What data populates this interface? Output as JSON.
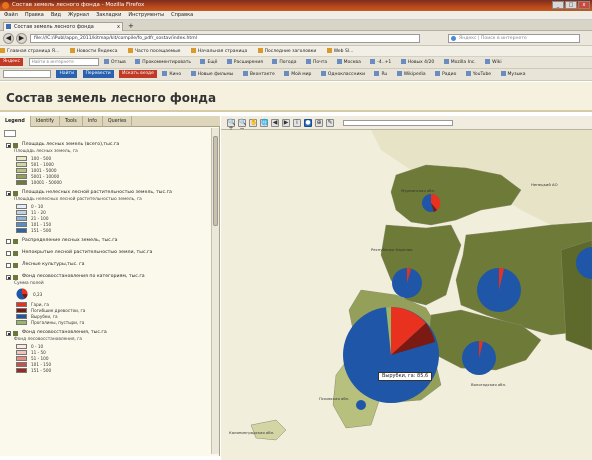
{
  "window": {
    "title": "Состав земель лесного фонда - Mozilla Firefox",
    "min": "_",
    "max": "□",
    "close": "x"
  },
  "menu": [
    "Файл",
    "Правка",
    "Вид",
    "Журнал",
    "Закладки",
    "Инструменты",
    "Справка"
  ],
  "tab": {
    "title": "Состав земель лесного фонда",
    "close": "x",
    "new": "+"
  },
  "nav": {
    "back": "◀",
    "forward": "▶",
    "url": "file:///C:/iPubl/appn_2011/kitmap/kit/compile/fo_pdfr_sostav/index.html",
    "search_placeholder": "Яндекс | Поиск в интернете"
  },
  "bookmarks": [
    "Главная страница Я...",
    "Новости Яндекса",
    "Часто посещаемые",
    "Начальная страница",
    "Последние заголовки",
    "Web Sl..."
  ],
  "toolbar1": {
    "logo": "Яндекс",
    "search_placeholder": "Найти в интернете",
    "items": [
      "Отзыв",
      "Прокомментировать",
      "Ещё",
      "Расширения",
      "Погода",
      "Почта",
      "Москва",
      "-4..+1",
      "Новых 4/20",
      "Mozilla Inc.",
      "Wiki"
    ]
  },
  "toolbar2": {
    "find_button": "Найти",
    "translate_button": "Перевести",
    "search_button": "Искать везде",
    "items": [
      "Кино",
      "Новые фильмы",
      "Вконтакте",
      "Мой мир",
      "Одноклассники",
      "Ru",
      "Wikipedia",
      "Радио",
      "YouTube",
      "Музыка"
    ]
  },
  "page": {
    "title": "Состав земель лесного фонда"
  },
  "panel_tabs": [
    "Legend",
    "Identify",
    "Tools",
    "Info",
    "Queries"
  ],
  "legend": {
    "layers": [
      {
        "checked": true,
        "title": "Площадь лесных земель (всего),тыс.га",
        "sub": "Площадь лесных земель, га",
        "classes": [
          {
            "label": "100 - 500",
            "color": "#eae8c6"
          },
          {
            "label": "501 - 1000",
            "color": "#d3d6a4"
          },
          {
            "label": "1001 - 5000",
            "color": "#b8c07e"
          },
          {
            "label": "5001 - 10000",
            "color": "#94a05a"
          },
          {
            "label": "10001 - 50000",
            "color": "#6e7a38"
          }
        ]
      },
      {
        "checked": true,
        "title": "Площадь нелесных лесной растительностью земель, тыс.га",
        "sub": "Площадь нелесных лесной растительностью земель, га",
        "classes": [
          {
            "label": "0 - 10",
            "color": "#e5edf7"
          },
          {
            "label": "11 - 20",
            "color": "#bcd3ea"
          },
          {
            "label": "21 - 100",
            "color": "#8fb4d9"
          },
          {
            "label": "101 - 150",
            "color": "#5b8dc3"
          },
          {
            "label": "151 - 500",
            "color": "#2e63a5"
          }
        ]
      },
      {
        "checked": false,
        "title": "Распределение лесных земель, тыс.га"
      },
      {
        "checked": false,
        "title": "Непокрытые лесной растительностью земли, тыс.га"
      },
      {
        "checked": false,
        "title": "Лесные культуры,тыс. га"
      },
      {
        "checked": true,
        "title": "Фонд лесовосстановления по категориям, тыс.га",
        "sub": "Сумма полей",
        "pie_value": "0,23",
        "categories": [
          {
            "label": "Гари, га",
            "color": "#e8321f"
          },
          {
            "label": "Погибшие древостои, га",
            "color": "#7a1a12"
          },
          {
            "label": "Вырубки, га",
            "color": "#1f56a8"
          },
          {
            "label": "Прогалины, пустыри, га",
            "color": "#96b868"
          }
        ]
      },
      {
        "checked": true,
        "title": "Фонд лесовосстановления, тыс.га",
        "sub": "Фонд лесовосстановления, га",
        "classes": [
          {
            "label": "0 - 10",
            "color": "#fbe9e6"
          },
          {
            "label": "11 - 50",
            "color": "#f1c2bb"
          },
          {
            "label": "51 - 100",
            "color": "#e08d83"
          },
          {
            "label": "101 - 150",
            "color": "#c4544a"
          },
          {
            "label": "151 - 500",
            "color": "#9a2720"
          }
        ]
      }
    ]
  },
  "map_tools": [
    "🔍+",
    "🔍−",
    "✋",
    "🌐",
    "◀",
    "▶",
    "i",
    "●",
    "⊕",
    "✎"
  ],
  "map": {
    "tooltip": "Вырубки, га: 85,6",
    "colors": {
      "forest_dark": "#6e7a38",
      "forest_mid": "#94a05a",
      "forest_light": "#b8c07e",
      "forest_pale": "#d3d6a4",
      "pie_blue": "#1f56a8",
      "pie_red": "#e8321f",
      "pie_dark": "#7a1a12",
      "pie_green": "#96b868"
    }
  }
}
